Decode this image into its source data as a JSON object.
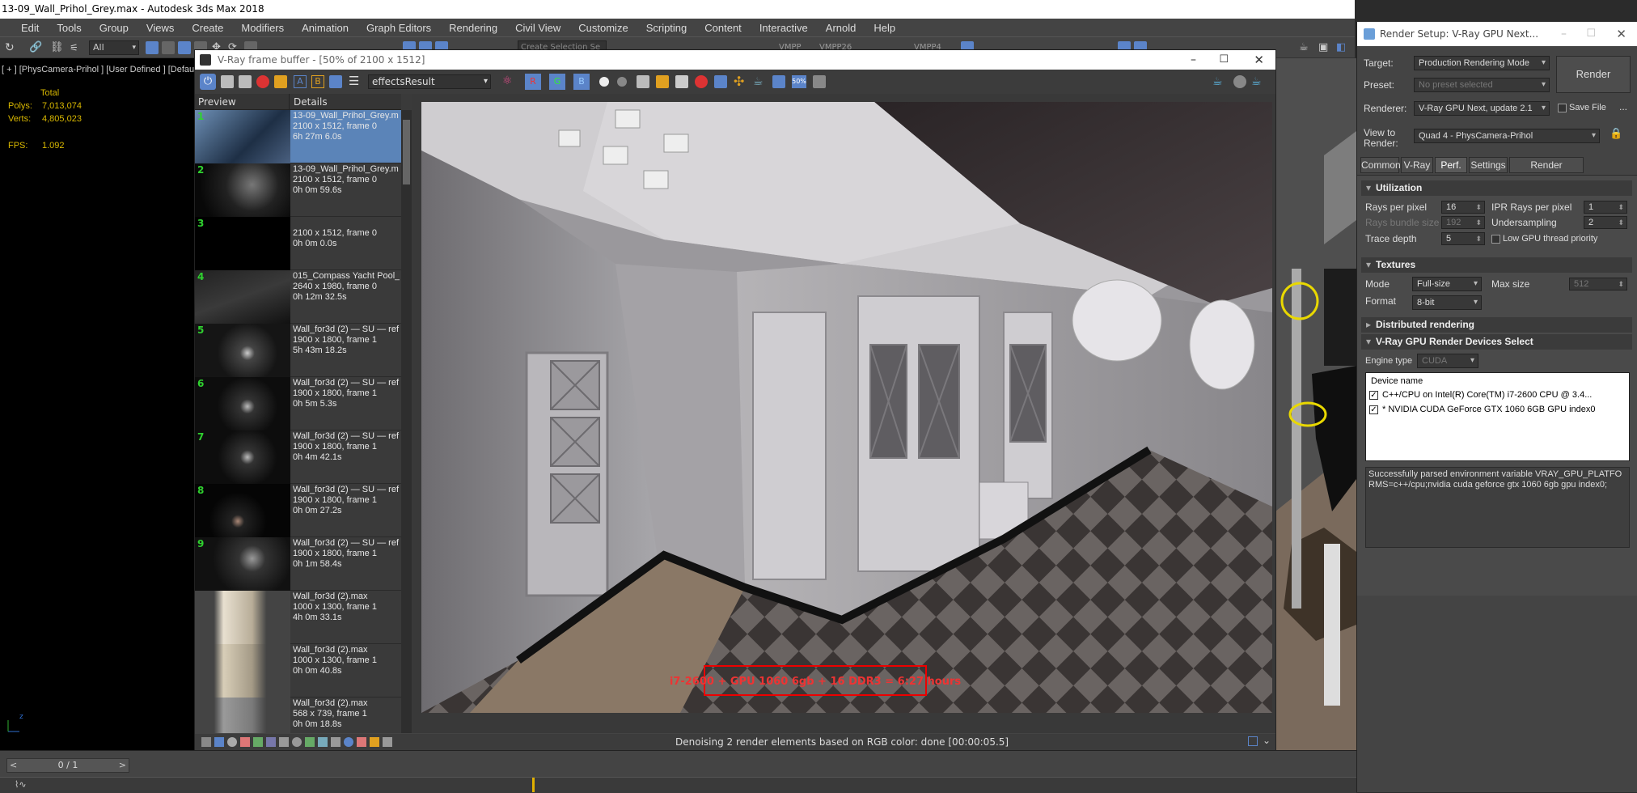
{
  "app": {
    "title": "13-09_Wall_Prihol_Grey.max - Autodesk 3ds Max 2018",
    "menu": [
      "Edit",
      "Tools",
      "Group",
      "Views",
      "Create",
      "Modifiers",
      "Animation",
      "Graph Editors",
      "Rendering",
      "Civil View",
      "Customize",
      "Scripting",
      "Content",
      "Interactive",
      "Arnold",
      "Help"
    ],
    "selection_filter": "All",
    "toolbar_right_labels": [
      "Create Selection Se",
      "VMPP",
      "VMPP26",
      "VMPP4"
    ]
  },
  "viewport": {
    "label": "[ + ] [PhysCamera-Prihol ] [User Defined ] [Default Shading ]",
    "stats": {
      "total_label": "Total",
      "polys_label": "Polys:",
      "polys": "7,013,074",
      "verts_label": "Verts:",
      "verts": "4,805,023",
      "fps_label": "FPS:",
      "fps": "1.092"
    }
  },
  "vfb": {
    "title": "V-Ray frame buffer - [50% of 2100 x 1512]",
    "channel": "effectsResult",
    "history_headers": {
      "preview": "Preview",
      "details": "Details"
    },
    "history": [
      {
        "num": "1",
        "name": "13-09_Wall_Prihol_Grey.m",
        "size": "2100 x 1512, frame 0",
        "time": "6h 27m 6.0s",
        "selected": true
      },
      {
        "num": "2",
        "name": "13-09_Wall_Prihol_Grey.m",
        "size": "2100 x 1512, frame 0",
        "time": "0h 0m 59.6s"
      },
      {
        "num": "3",
        "name": "",
        "size": "2100 x 1512, frame 0",
        "time": "0h 0m 0.0s"
      },
      {
        "num": "4",
        "name": "015_Compass Yacht Pool_'",
        "size": "2640 x 1980, frame 0",
        "time": "0h 12m 32.5s"
      },
      {
        "num": "5",
        "name": "Wall_for3d (2) — SU — ref",
        "size": "1900 x 1800, frame 1",
        "time": "5h 43m 18.2s"
      },
      {
        "num": "6",
        "name": "Wall_for3d (2) — SU — ref",
        "size": "1900 x 1800, frame 1",
        "time": "0h 5m 5.3s"
      },
      {
        "num": "7",
        "name": "Wall_for3d (2) — SU — ref",
        "size": "1900 x 1800, frame 1",
        "time": "0h 4m 42.1s"
      },
      {
        "num": "8",
        "name": "Wall_for3d (2) — SU — ref",
        "size": "1900 x 1800, frame 1",
        "time": "0h 0m 27.2s"
      },
      {
        "num": "9",
        "name": "Wall_for3d (2) — SU — ref",
        "size": "1900 x 1800, frame 1",
        "time": "0h 1m 58.4s"
      },
      {
        "num": "",
        "name": "Wall_for3d (2).max",
        "size": "1000 x 1300, frame 1",
        "time": "4h 0m 33.1s"
      },
      {
        "num": "",
        "name": "Wall_for3d (2).max",
        "size": "1000 x 1300, frame 1",
        "time": "0h 0m 40.8s"
      },
      {
        "num": "",
        "name": "Wall_for3d (2).max",
        "size": "568 x 739, frame 1",
        "time": "0h 0m 18.8s"
      }
    ],
    "watermark": "i7-2600 + GPU 1060 6gb + 16 DDR3 = 6:27 hours",
    "status": "Denoising 2 render elements based on RGB color: done [00:00:05.5]"
  },
  "render_setup": {
    "title": "Render Setup: V-Ray GPU Next...",
    "target_label": "Target:",
    "target": "Production Rendering Mode",
    "preset_label": "Preset:",
    "preset": "No preset selected",
    "renderer_label": "Renderer:",
    "renderer": "V-Ray GPU Next, update 2.1",
    "save_file": "Save File",
    "view_label": "View to Render:",
    "view": "Quad 4 - PhysCamera-Prihol",
    "render_button": "Render",
    "tabs": [
      "Common",
      "V-Ray",
      "Perf.",
      "Settings",
      "Render Elements"
    ],
    "utilization": {
      "title": "Utilization",
      "rays_per_pixel_label": "Rays per pixel",
      "rays_per_pixel": "16",
      "ipr_rays_label": "IPR Rays per pixel",
      "ipr_rays": "1",
      "rays_bundle_label": "Rays bundle size",
      "rays_bundle": "192",
      "undersampling_label": "Undersampling",
      "undersampling": "2",
      "trace_depth_label": "Trace depth",
      "trace_depth": "5",
      "low_priority": "Low GPU thread priority"
    },
    "textures": {
      "title": "Textures",
      "mode_label": "Mode",
      "mode": "Full-size",
      "max_size_label": "Max size",
      "max_size": "512",
      "format_label": "Format",
      "format": "8-bit"
    },
    "distributed": "Distributed rendering",
    "devices": {
      "title": "V-Ray GPU Render Devices Select",
      "engine_label": "Engine type",
      "engine": "CUDA",
      "header": "Device name",
      "list": [
        "C++/CPU on Intel(R) Core(TM) i7-2600 CPU @ 3.4...",
        "* NVIDIA CUDA GeForce GTX 1060 6GB GPU index0"
      ]
    },
    "log": "Successfully parsed environment variable VRAY_GPU_PLATFORMS=c++/cpu;nvidia cuda geforce gtx 1060 6gb gpu index0;"
  },
  "timeline": {
    "frame": "0 / 1"
  }
}
